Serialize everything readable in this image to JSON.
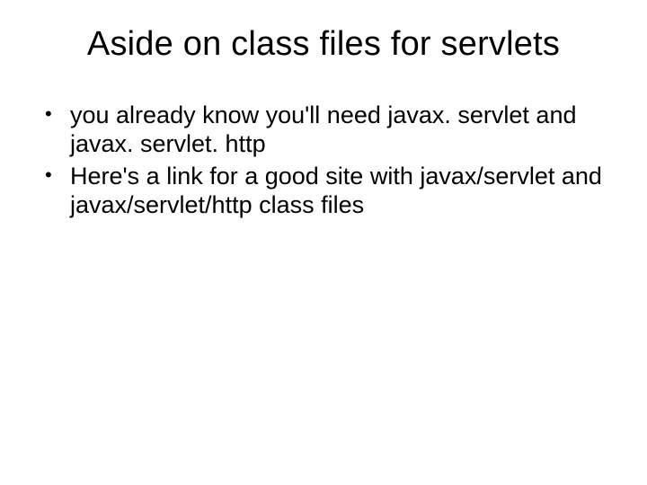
{
  "slide": {
    "title": "Aside on class files for servlets",
    "bullets": [
      "you already know you'll need javax. servlet and javax. servlet. http",
      "Here's a link for a good site with javax/servlet and javax/servlet/http class files"
    ]
  }
}
